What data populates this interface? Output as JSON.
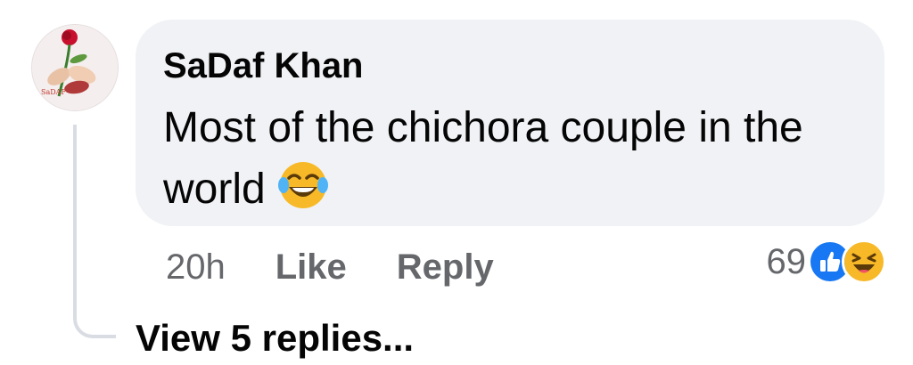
{
  "comment": {
    "author": "SaDaf Khan",
    "avatar_text": "SaDAF",
    "text": "Most of the chichora couple in the world",
    "emoji_icon": "face-with-tears-of-joy-icon",
    "time": "20h",
    "like_label": "Like",
    "reply_label": "Reply",
    "reaction_count": "69",
    "reaction_icons": [
      "like-reaction-icon",
      "haha-reaction-icon"
    ]
  },
  "thread": {
    "view_replies_label": "View 5 replies..."
  },
  "colors": {
    "bubble_bg": "#f0f2f5",
    "secondary_text": "#65676b",
    "like_blue": "#1877f2",
    "haha_yellow": "#f7b928"
  }
}
